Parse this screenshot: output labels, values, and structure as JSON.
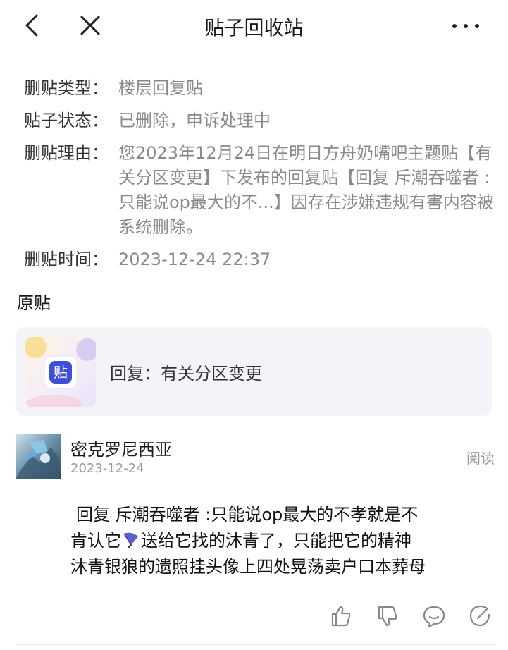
{
  "header": {
    "title": "贴子回收站"
  },
  "info": {
    "type_label": "删贴类型：",
    "type_value": "楼层回复贴",
    "status_label": "贴子状态：",
    "status_value": "已删除，申诉处理中",
    "reason_label": "删贴理由：",
    "reason_value": "您2023年12月24日在明日方舟奶嘴吧主题贴【有关分区变更】下发布的回复贴【回复 斥潮吞噬者 :只能说op最大的不...】因存在涉嫌违规有害内容被系统删除。",
    "time_label": "删贴时间：",
    "time_value": "2023-12-24 22:37"
  },
  "original": {
    "section_label": "原贴",
    "card_icon_text": "贴",
    "card_text": "回复：有关分区变更"
  },
  "post": {
    "author": "密克罗尼西亚",
    "date": "2023-12-24",
    "read_label": "阅读",
    "line1": "回复  斥潮吞噬者 :只能说op最大的不孝就是不",
    "line2_a": "肯认它",
    "line2_b": "送给它找的沐青了，只能把它的精神",
    "line3": "沐青银狼的遗照挂头像上四处晃荡卖户口本葬母"
  },
  "colors": {
    "label": "#333333",
    "value": "#8a8a8a",
    "card_bg": "#f3f3f8",
    "badge": "#3d4fd6"
  },
  "icons": [
    "back-icon",
    "close-icon",
    "more-icon",
    "umbrella-icon",
    "like-icon",
    "dislike-icon",
    "comment-icon",
    "share-icon"
  ]
}
